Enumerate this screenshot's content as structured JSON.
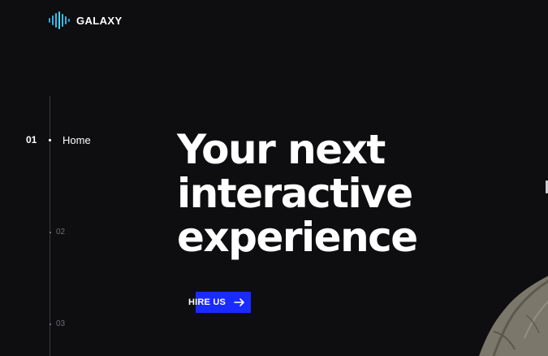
{
  "brand": {
    "name": "GALAXY",
    "icon": "audio-wave-logo-icon",
    "colors": [
      "#27a8e8",
      "#4ad0f0"
    ]
  },
  "nav": {
    "active": {
      "number": "01",
      "label": "Home"
    },
    "items": [
      {
        "number": "02"
      },
      {
        "number": "03"
      }
    ]
  },
  "hero": {
    "lines": [
      "Your next",
      "interactive",
      "experience"
    ]
  },
  "cta": {
    "label": "HIRE US",
    "icon": "arrow-right-icon",
    "color": "#1a2bff"
  },
  "accent": "#1a2bff"
}
